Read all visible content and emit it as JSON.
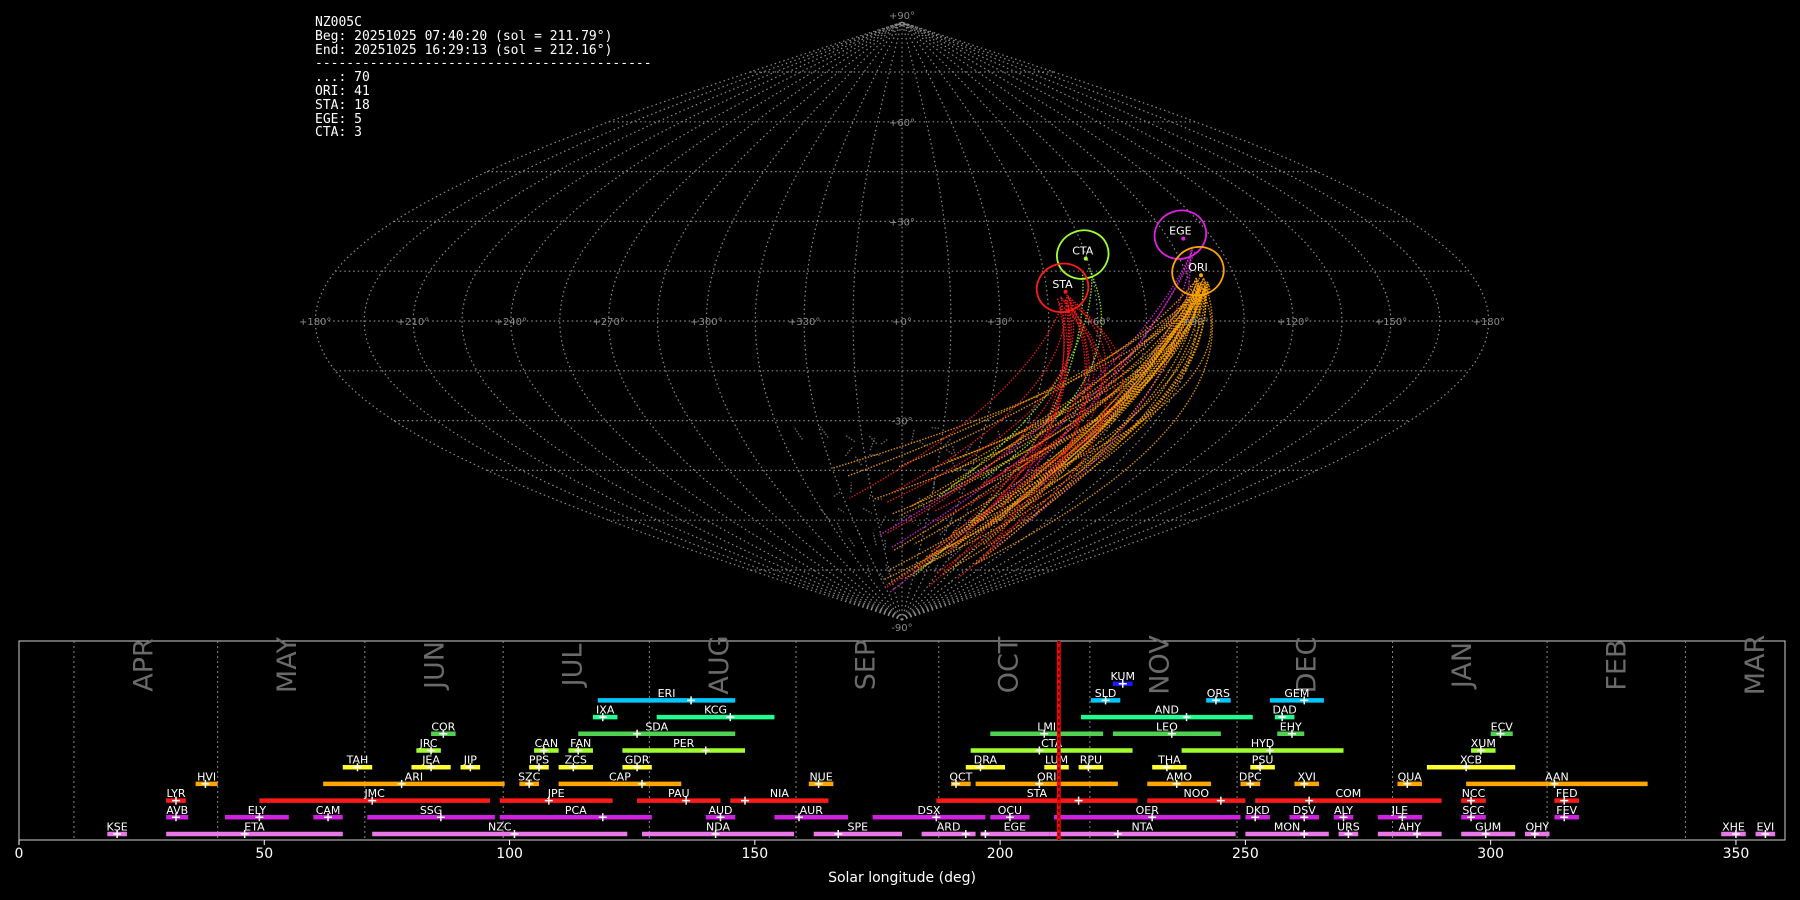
{
  "info": {
    "station": "NZ005C",
    "begin": "Beg: 20251025 07:40:20 (sol = 211.79°)",
    "end": "End: 20251025 16:29:13 (sol = 212.16°)",
    "separator": "-------------------------------------------",
    "counts": [
      {
        "code": "...",
        "count": 70
      },
      {
        "code": "ORI",
        "count": 41
      },
      {
        "code": "STA",
        "count": 18
      },
      {
        "code": "EGE",
        "count": 5
      },
      {
        "code": "CTA",
        "count": 3
      }
    ]
  },
  "chart_data": [
    {
      "type": "scatter",
      "subtype": "sinusoidal sky map of meteor radiants and trails",
      "longitude_ticks": [
        "+180°",
        "+150°",
        "+120°",
        "+90°",
        "+60°",
        "+30°",
        "+0°",
        "+330°",
        "+300°",
        "+270°",
        "+240°",
        "+210°",
        "+180°"
      ],
      "latitude_ticks": [
        "+90°",
        "+60°",
        "+30°",
        "-30°",
        "-90°"
      ],
      "longitude_range": [
        180,
        -180
      ],
      "latitude_range": [
        -90,
        90
      ],
      "grid": true,
      "radiants": [
        {
          "code": "EGE",
          "lon": 95,
          "lat": 26,
          "color": "#e020e0",
          "meteors": 5
        },
        {
          "code": "ORI",
          "lon": 94,
          "lat": 15,
          "color": "#ffa500",
          "meteors": 41
        },
        {
          "code": "CTA",
          "lon": 59,
          "lat": 20,
          "color": "#a0ff30",
          "meteors": 3
        },
        {
          "code": "STA",
          "lon": 50,
          "lat": 10,
          "color": "#ff1a1a",
          "meteors": 18
        }
      ],
      "sporadic_color": "#777777",
      "sporadic_count": 70
    },
    {
      "type": "bar",
      "subtype": "meteor shower activity timeline",
      "xlabel": "Solar longitude (deg)",
      "xlim": [
        0,
        360
      ],
      "xticks": [
        0,
        50,
        100,
        150,
        200,
        250,
        300,
        350
      ],
      "current_sol": [
        211.79,
        212.16
      ],
      "current_color": "#ff0000",
      "months": [
        {
          "name": "APR",
          "start": 11.2
        },
        {
          "name": "MAY",
          "start": 40.5
        },
        {
          "name": "JUN",
          "start": 70.5
        },
        {
          "name": "JUL",
          "start": 98.7
        },
        {
          "name": "AUG",
          "start": 128.5
        },
        {
          "name": "SEP",
          "start": 158.4
        },
        {
          "name": "OCT",
          "start": 187.5
        },
        {
          "name": "NOV",
          "start": 218.3
        },
        {
          "name": "DEC",
          "start": 248.3
        },
        {
          "name": "JAN",
          "start": 280.0
        },
        {
          "name": "FEB",
          "start": 311.5
        },
        {
          "name": "MAR",
          "start": 339.7
        }
      ],
      "showers": [
        {
          "code": "KUM",
          "start": 223,
          "end": 227,
          "peak": 225,
          "row": 9,
          "color": "#1a1aff"
        },
        {
          "code": "ERI",
          "start": 118,
          "end": 146,
          "peak": 137,
          "row": 8,
          "color": "#00c8ff"
        },
        {
          "code": "SLD",
          "start": 218.5,
          "end": 224.5,
          "peak": 221.5,
          "row": 8,
          "color": "#00c8ff"
        },
        {
          "code": "ORS",
          "start": 242,
          "end": 247,
          "peak": 244,
          "row": 8,
          "color": "#00c8ff"
        },
        {
          "code": "GEM",
          "start": 255,
          "end": 266,
          "peak": 262,
          "row": 8,
          "color": "#00c8ff"
        },
        {
          "code": "IXA",
          "start": 117,
          "end": 122,
          "peak": 119,
          "row": 7,
          "color": "#20ff90"
        },
        {
          "code": "KCG",
          "start": 130,
          "end": 154,
          "peak": 145,
          "row": 7,
          "color": "#20ff90"
        },
        {
          "code": "AND",
          "start": 216.5,
          "end": 251.5,
          "peak": 238,
          "row": 7,
          "color": "#20ff90"
        },
        {
          "code": "DAD",
          "start": 256,
          "end": 260,
          "peak": 257.5,
          "row": 7,
          "color": "#20ff90"
        },
        {
          "code": "COR",
          "start": 84,
          "end": 89,
          "peak": 86.5,
          "row": 6,
          "color": "#50d050"
        },
        {
          "code": "SDA",
          "start": 114,
          "end": 146,
          "peak": 126,
          "row": 6,
          "color": "#50d050"
        },
        {
          "code": "LMI",
          "start": 198,
          "end": 221,
          "peak": 209,
          "row": 6,
          "color": "#50d050"
        },
        {
          "code": "LEO",
          "start": 223,
          "end": 245,
          "peak": 235,
          "row": 6,
          "color": "#50d050"
        },
        {
          "code": "EHY",
          "start": 256.5,
          "end": 262,
          "peak": 259.5,
          "row": 6,
          "color": "#50d050"
        },
        {
          "code": "ECV",
          "start": 300,
          "end": 304.5,
          "peak": 302,
          "row": 6,
          "color": "#50d050"
        },
        {
          "code": "JRC",
          "start": 81,
          "end": 86,
          "peak": 84,
          "row": 5,
          "color": "#a0ff30"
        },
        {
          "code": "CAN",
          "start": 105,
          "end": 110,
          "peak": 107,
          "row": 5,
          "color": "#a0ff30"
        },
        {
          "code": "FAN",
          "start": 112,
          "end": 117,
          "peak": 114,
          "row": 5,
          "color": "#a0ff30"
        },
        {
          "code": "PER",
          "start": 123,
          "end": 148,
          "peak": 140,
          "row": 5,
          "color": "#a0ff30"
        },
        {
          "code": "CTA",
          "start": 194,
          "end": 227,
          "peak": 208,
          "row": 5,
          "color": "#a0ff30"
        },
        {
          "code": "HYD",
          "start": 237,
          "end": 270,
          "peak": 255,
          "row": 5,
          "color": "#a0ff30"
        },
        {
          "code": "XUM",
          "start": 296,
          "end": 301,
          "peak": 298,
          "row": 5,
          "color": "#a0ff30"
        },
        {
          "code": "TAH",
          "start": 66,
          "end": 72,
          "peak": 69,
          "row": 4,
          "color": "#ffff30"
        },
        {
          "code": "JEA",
          "start": 80,
          "end": 88,
          "peak": 84,
          "row": 4,
          "color": "#ffff30"
        },
        {
          "code": "JIP",
          "start": 90,
          "end": 94,
          "peak": 92,
          "row": 4,
          "color": "#ffff30"
        },
        {
          "code": "PPS",
          "start": 104,
          "end": 108,
          "peak": 106,
          "row": 4,
          "color": "#ffff30"
        },
        {
          "code": "ZCS",
          "start": 110,
          "end": 117,
          "peak": 113,
          "row": 4,
          "color": "#ffff30"
        },
        {
          "code": "GDR",
          "start": 123,
          "end": 129,
          "peak": 126,
          "row": 4,
          "color": "#ffff30"
        },
        {
          "code": "DRA",
          "start": 193,
          "end": 201,
          "peak": 196,
          "row": 4,
          "color": "#ffff30"
        },
        {
          "code": "LUM",
          "start": 209,
          "end": 214,
          "peak": 212,
          "row": 4,
          "color": "#ffff30"
        },
        {
          "code": "RPU",
          "start": 216,
          "end": 221,
          "peak": 218,
          "row": 4,
          "color": "#ffff30"
        },
        {
          "code": "THA",
          "start": 231,
          "end": 238,
          "peak": 234,
          "row": 4,
          "color": "#ffff30"
        },
        {
          "code": "PSU",
          "start": 251,
          "end": 256,
          "peak": 253,
          "row": 4,
          "color": "#ffff30"
        },
        {
          "code": "XCB",
          "start": 287,
          "end": 305,
          "peak": 295,
          "row": 4,
          "color": "#ffff30"
        },
        {
          "code": "HVI",
          "start": 36,
          "end": 40.5,
          "peak": 38,
          "row": 3,
          "color": "#ffa500"
        },
        {
          "code": "ARI",
          "start": 62,
          "end": 99,
          "peak": 78,
          "row": 3,
          "color": "#ffa500"
        },
        {
          "code": "SZC",
          "start": 102,
          "end": 106,
          "peak": 104,
          "row": 3,
          "color": "#ffa500"
        },
        {
          "code": "CAP",
          "start": 110,
          "end": 135,
          "peak": 127,
          "row": 3,
          "color": "#ffa500"
        },
        {
          "code": "NUE",
          "start": 161,
          "end": 166,
          "peak": 163,
          "row": 3,
          "color": "#ffa500"
        },
        {
          "code": "OCT",
          "start": 190,
          "end": 194,
          "peak": 191,
          "row": 3,
          "color": "#ffa500"
        },
        {
          "code": "ORI",
          "start": 195,
          "end": 224,
          "peak": 208,
          "row": 3,
          "color": "#ffa500"
        },
        {
          "code": "AMO",
          "start": 230,
          "end": 243,
          "peak": 236,
          "row": 3,
          "color": "#ffa500"
        },
        {
          "code": "DPC",
          "start": 249,
          "end": 253,
          "peak": 251,
          "row": 3,
          "color": "#ffa500"
        },
        {
          "code": "XVI",
          "start": 260,
          "end": 265,
          "peak": 262,
          "row": 3,
          "color": "#ffa500"
        },
        {
          "code": "QUA",
          "start": 281,
          "end": 286,
          "peak": 283,
          "row": 3,
          "color": "#ffa500"
        },
        {
          "code": "AAN",
          "start": 295,
          "end": 332,
          "peak": 313,
          "row": 3,
          "color": "#ffa500"
        },
        {
          "code": "LYR",
          "start": 30,
          "end": 34,
          "peak": 32,
          "row": 2,
          "color": "#ff1a1a"
        },
        {
          "code": "JMC",
          "start": 49,
          "end": 96,
          "peak": 72,
          "row": 2,
          "color": "#ff1a1a"
        },
        {
          "code": "JPE",
          "start": 98,
          "end": 121,
          "peak": 108,
          "row": 2,
          "color": "#ff1a1a"
        },
        {
          "code": "PAU",
          "start": 126,
          "end": 143,
          "peak": 136,
          "row": 2,
          "color": "#ff1a1a"
        },
        {
          "code": "NIA",
          "start": 145,
          "end": 165,
          "peak": 148,
          "row": 2,
          "color": "#ff1a1a"
        },
        {
          "code": "STA",
          "start": 187,
          "end": 228,
          "peak": 216,
          "row": 2,
          "color": "#ff1a1a"
        },
        {
          "code": "NOO",
          "start": 230,
          "end": 250,
          "peak": 245,
          "row": 2,
          "color": "#ff1a1a"
        },
        {
          "code": "COM",
          "start": 252,
          "end": 290,
          "peak": 263,
          "row": 2,
          "color": "#ff1a1a"
        },
        {
          "code": "NCC",
          "start": 294,
          "end": 299,
          "peak": 296,
          "row": 2,
          "color": "#ff1a1a"
        },
        {
          "code": "FED",
          "start": 313,
          "end": 318,
          "peak": 315,
          "row": 2,
          "color": "#ff1a1a"
        },
        {
          "code": "AVB",
          "start": 30,
          "end": 34.5,
          "peak": 32,
          "row": 1,
          "color": "#d020e0"
        },
        {
          "code": "ELY",
          "start": 42,
          "end": 55,
          "peak": 49,
          "row": 1,
          "color": "#d020e0"
        },
        {
          "code": "CAM",
          "start": 60,
          "end": 66,
          "peak": 63,
          "row": 1,
          "color": "#d020e0"
        },
        {
          "code": "SSG",
          "start": 71,
          "end": 97,
          "peak": 86,
          "row": 1,
          "color": "#d020e0"
        },
        {
          "code": "PCA",
          "start": 98,
          "end": 129,
          "peak": 119,
          "row": 1,
          "color": "#d020e0"
        },
        {
          "code": "AUD",
          "start": 140,
          "end": 146,
          "peak": 143,
          "row": 1,
          "color": "#d020e0"
        },
        {
          "code": "AUR",
          "start": 154,
          "end": 169,
          "peak": 159,
          "row": 1,
          "color": "#d020e0"
        },
        {
          "code": "DSX",
          "start": 174,
          "end": 197,
          "peak": 187,
          "row": 1,
          "color": "#d020e0"
        },
        {
          "code": "OCU",
          "start": 198,
          "end": 206,
          "peak": 202,
          "row": 1,
          "color": "#d020e0"
        },
        {
          "code": "OER",
          "start": 211,
          "end": 249,
          "peak": 231,
          "row": 1,
          "color": "#d020e0"
        },
        {
          "code": "DKD",
          "start": 250,
          "end": 255,
          "peak": 252,
          "row": 1,
          "color": "#d020e0"
        },
        {
          "code": "DSV",
          "start": 259,
          "end": 265,
          "peak": 262,
          "row": 1,
          "color": "#d020e0"
        },
        {
          "code": "ALY",
          "start": 268,
          "end": 272,
          "peak": 270,
          "row": 1,
          "color": "#d020e0"
        },
        {
          "code": "JLE",
          "start": 277,
          "end": 286,
          "peak": 282,
          "row": 1,
          "color": "#d020e0"
        },
        {
          "code": "SCC",
          "start": 294,
          "end": 299,
          "peak": 296,
          "row": 1,
          "color": "#d020e0"
        },
        {
          "code": "FEV",
          "start": 313,
          "end": 318,
          "peak": 315,
          "row": 1,
          "color": "#d020e0"
        },
        {
          "code": "KSE",
          "start": 18,
          "end": 22,
          "peak": 20,
          "row": 0,
          "color": "#e878e8"
        },
        {
          "code": "ETA",
          "start": 30,
          "end": 66,
          "peak": 46,
          "row": 0,
          "color": "#e878e8"
        },
        {
          "code": "NZC",
          "start": 72,
          "end": 124,
          "peak": 101,
          "row": 0,
          "color": "#e878e8"
        },
        {
          "code": "NDA",
          "start": 127,
          "end": 158,
          "peak": 142,
          "row": 0,
          "color": "#e878e8"
        },
        {
          "code": "SPE",
          "start": 162,
          "end": 180,
          "peak": 167,
          "row": 0,
          "color": "#e878e8"
        },
        {
          "code": "ARD",
          "start": 184,
          "end": 195,
          "peak": 193,
          "row": 0,
          "color": "#e878e8"
        },
        {
          "code": "EGE",
          "start": 196,
          "end": 210,
          "peak": 197,
          "row": 0,
          "color": "#e878e8"
        },
        {
          "code": "NTA",
          "start": 210,
          "end": 248,
          "peak": 224,
          "row": 0,
          "color": "#e878e8"
        },
        {
          "code": "MON",
          "start": 250,
          "end": 267,
          "peak": 262,
          "row": 0,
          "color": "#e878e8"
        },
        {
          "code": "URS",
          "start": 269,
          "end": 273,
          "peak": 271,
          "row": 0,
          "color": "#e878e8"
        },
        {
          "code": "AHY",
          "start": 277,
          "end": 290,
          "peak": 285,
          "row": 0,
          "color": "#e878e8"
        },
        {
          "code": "GUM",
          "start": 294,
          "end": 305,
          "peak": 299,
          "row": 0,
          "color": "#e878e8"
        },
        {
          "code": "OHY",
          "start": 307,
          "end": 312,
          "peak": 309,
          "row": 0,
          "color": "#e878e8"
        },
        {
          "code": "XHE",
          "start": 347,
          "end": 352,
          "peak": 350,
          "row": 0,
          "color": "#e878e8"
        },
        {
          "code": "EVI",
          "start": 354,
          "end": 358,
          "peak": 356,
          "row": 0,
          "color": "#e878e8"
        }
      ]
    }
  ]
}
